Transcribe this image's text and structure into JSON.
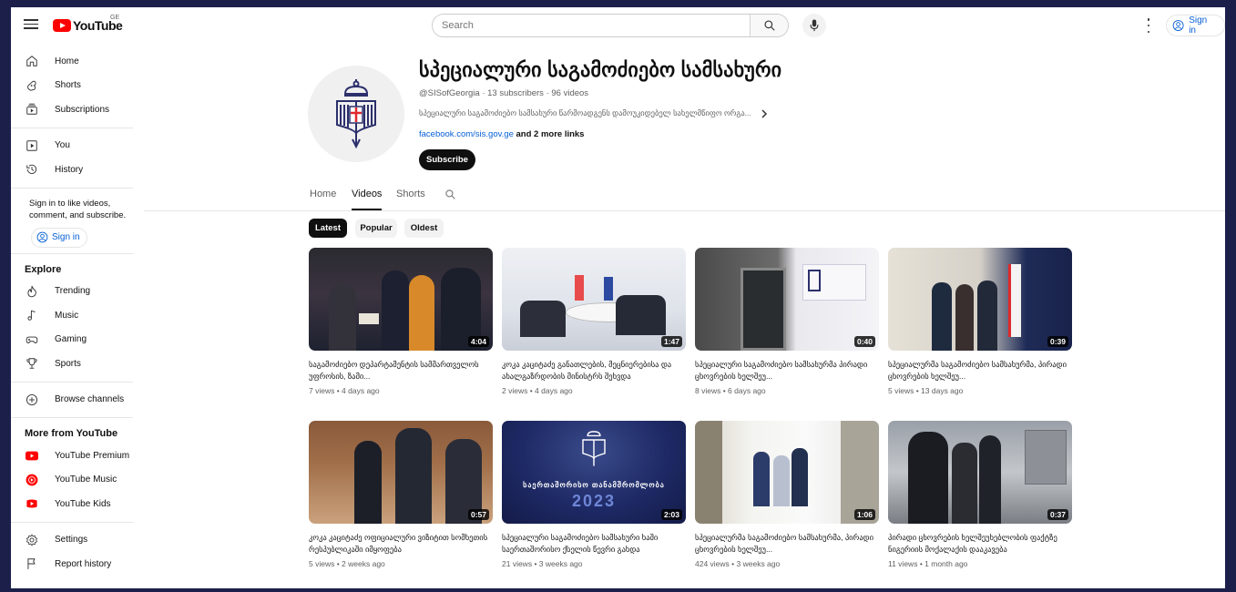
{
  "header": {
    "logo_text": "YouTube",
    "country_code": "GE",
    "search_placeholder": "Search",
    "signin_label": "Sign in"
  },
  "sidebar": {
    "items_top": [
      {
        "label": "Home",
        "icon": "home-icon"
      },
      {
        "label": "Shorts",
        "icon": "shorts-icon"
      },
      {
        "label": "Subscriptions",
        "icon": "subscriptions-icon"
      }
    ],
    "items_you": [
      {
        "label": "You",
        "icon": "you-icon"
      },
      {
        "label": "History",
        "icon": "history-icon"
      }
    ],
    "signin_message": "Sign in to like videos, comment, and subscribe.",
    "signin_label": "Sign in",
    "explore_heading": "Explore",
    "explore_items": [
      {
        "label": "Trending",
        "icon": "trending-icon"
      },
      {
        "label": "Music",
        "icon": "music-icon"
      },
      {
        "label": "Gaming",
        "icon": "gaming-icon"
      },
      {
        "label": "Sports",
        "icon": "sports-icon"
      }
    ],
    "browse_label": "Browse channels",
    "more_heading": "More from YouTube",
    "more_items": [
      {
        "label": "YouTube Premium",
        "icon": "youtube-premium-icon"
      },
      {
        "label": "YouTube Music",
        "icon": "youtube-music-icon"
      },
      {
        "label": "YouTube Kids",
        "icon": "youtube-kids-icon"
      }
    ],
    "settings_label": "Settings",
    "report_label": "Report history"
  },
  "channel": {
    "title": "სპეციალური საგამოძიებო სამსახური",
    "handle": "@SISofGeorgia",
    "subscribers": "13 subscribers",
    "video_count": "96 videos",
    "meta_separator": "·",
    "description": "სპეციალური საგამოძიებო სამსახური წარმოადგენს დამოუკიდებელ სახელმწიფო ორგა...",
    "link": "facebook.com/sis.gov.ge",
    "more_links": "and 2 more links",
    "subscribe_label": "Subscribe"
  },
  "tabs": [
    "Home",
    "Videos",
    "Shorts"
  ],
  "active_tab": "Videos",
  "chips": [
    "Latest",
    "Popular",
    "Oldest"
  ],
  "active_chip": "Latest",
  "videos": [
    {
      "title": "საგამოძიებო დეპარტამენტის სამმართველოს უფროსის, ზამი...",
      "views": "7 views",
      "age": "4 days ago",
      "duration": "4:04"
    },
    {
      "title": "კოკა კაციტაძე განათლების, მეცნიერებისა და ახალგაზრდობის მინისტრს შეხვდა",
      "views": "2 views",
      "age": "4 days ago",
      "duration": "1:47"
    },
    {
      "title": "სპეციალური საგამოძიებო სამსახურმა პირადი ცხოვრების ხელშეუ...",
      "views": "8 views",
      "age": "6 days ago",
      "duration": "0:40"
    },
    {
      "title": "სპეციალურმა საგამოძიებო სამსახურმა, პირადი ცხოვრების ხელშეუ...",
      "views": "5 views",
      "age": "13 days ago",
      "duration": "0:39"
    },
    {
      "title": "კოკა კაციტაძე ოფიციალური ვიზიტით სომხეთის რესპუბლიკაში იმყოფება",
      "views": "5 views",
      "age": "2 weeks ago",
      "duration": "0:57"
    },
    {
      "title": "სპეციალური საგამოძიებო სამსახური ხაში საერთაშორისო ქსელის წევრი გახდა",
      "views": "21 views",
      "age": "3 weeks ago",
      "duration": "2:03"
    },
    {
      "title": "სპეციალურმა საგამოძიებო სამსახურმა, პირადი ცხოვრების ხელშეუ...",
      "views": "424 views",
      "age": "3 weeks ago",
      "duration": "1:06"
    },
    {
      "title": "პირადი ცხოვრების ხელშეუხებლობის ფაქტზე ნიგერიის მოქალაქის დააკავება",
      "views": "11 views",
      "age": "1 month ago",
      "duration": "0:37"
    }
  ],
  "thumb2023": {
    "caption": "საერთაშორისო თანამშრომლობა",
    "year": "2023"
  },
  "colors": {
    "accent": "#065fd4",
    "brand_red": "#ff0000",
    "logo_navy": "#2b2f6b"
  }
}
